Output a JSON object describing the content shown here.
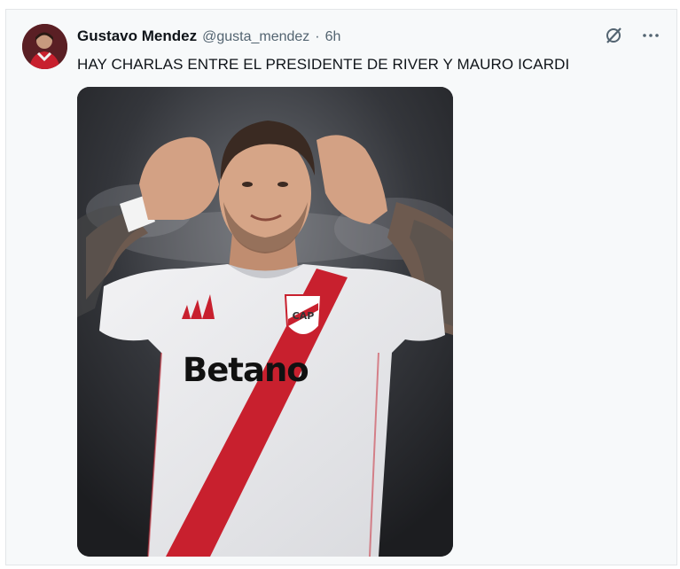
{
  "tweet": {
    "author_name": "Gustavo Mendez",
    "handle": "@gusta_mendez",
    "separator": "·",
    "time": "6h",
    "text": "HAY CHARLAS ENTRE EL PRESIDENTE DE RIVER Y MAURO ICARDI",
    "icons": {
      "grok": "grok-icon",
      "more": "more-options-icon"
    }
  },
  "media": {
    "sponsor_text": "Betano",
    "colors": {
      "sash": "#c8202e",
      "shirt": "#e9e9ec",
      "background": "#2b2d31"
    }
  }
}
